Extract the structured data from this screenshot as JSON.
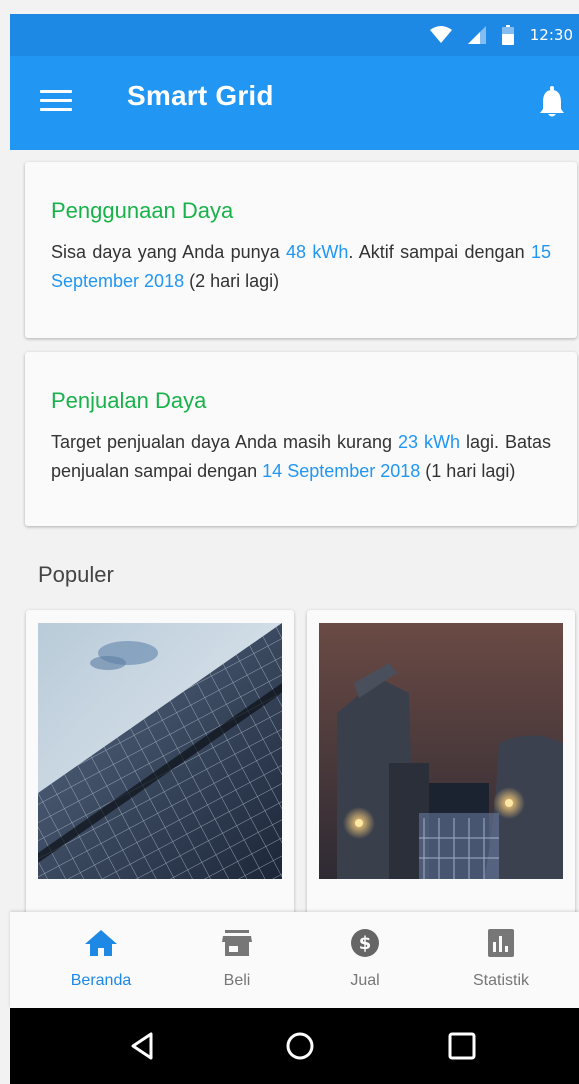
{
  "status_bar": {
    "time": "12:30",
    "icons": [
      "wifi-icon",
      "cell-signal-icon",
      "battery-icon"
    ]
  },
  "app_bar": {
    "title": "Smart Grid",
    "menu_icon": "menu-icon",
    "notification_icon": "bell-icon"
  },
  "cards": [
    {
      "title": "Penggunaan Daya",
      "text_parts": [
        "Sisa daya yang Anda punya ",
        "48 kWh",
        ". Aktif sampai dengan ",
        "15 September 2018",
        " (2 hari lagi)"
      ]
    },
    {
      "title": "Penjualan Daya",
      "text_parts": [
        "Target penjualan daya Anda masih kurang ",
        "23 kWh",
        " lagi. Batas penjualan sampai dengan ",
        "14 September 2018",
        " (1 hari lagi)"
      ]
    }
  ],
  "popular": {
    "title": "Populer",
    "items": [
      {
        "image": "solar-panel-image"
      },
      {
        "image": "power-plant-image"
      }
    ]
  },
  "bottom_nav": {
    "items": [
      {
        "label": "Beranda",
        "icon": "home-icon",
        "active": true
      },
      {
        "label": "Beli",
        "icon": "store-icon",
        "active": false
      },
      {
        "label": "Jual",
        "icon": "dollar-icon",
        "active": false
      },
      {
        "label": "Statistik",
        "icon": "bar-chart-icon",
        "active": false
      }
    ]
  },
  "system_nav": {
    "buttons": [
      "back-icon",
      "home-circle-icon",
      "recents-icon"
    ]
  },
  "colors": {
    "primary": "#2196f3",
    "status_bar": "#1e88e5",
    "card_title": "#19b24a",
    "highlight": "#2196f3"
  }
}
